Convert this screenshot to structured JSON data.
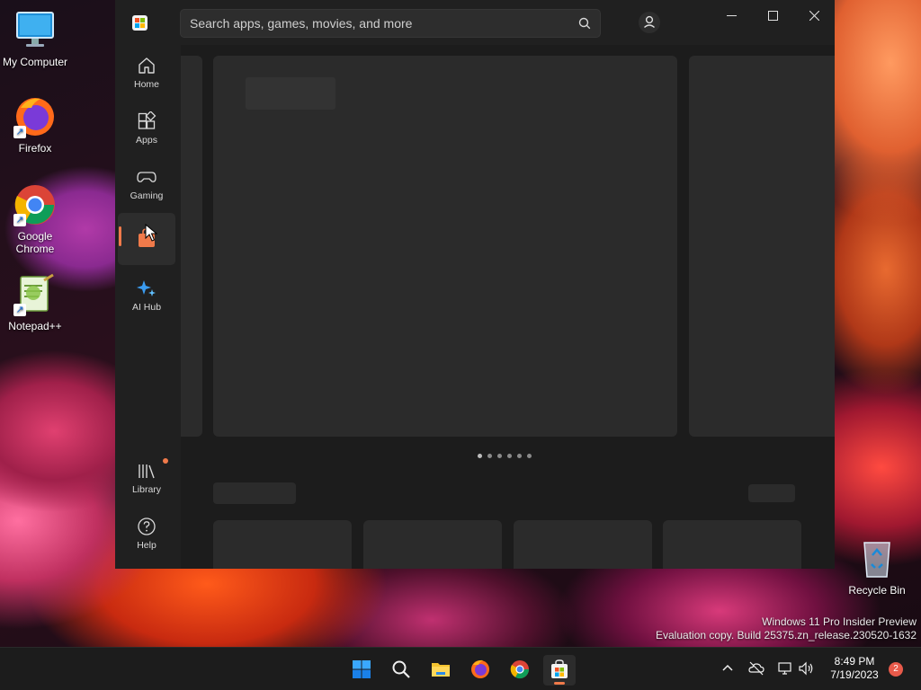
{
  "desktop": {
    "icons": [
      {
        "label": "My Computer"
      },
      {
        "label": "Firefox"
      },
      {
        "label": "Google Chrome"
      },
      {
        "label": "Notepad++"
      },
      {
        "label": "Recycle Bin"
      }
    ],
    "watermark": {
      "line1": "Windows 11 Pro Insider Preview",
      "line2": "Evaluation copy. Build 25375.zn_release.230520-1632"
    }
  },
  "store": {
    "search_placeholder": "Search apps, games, movies, and more",
    "nav": [
      {
        "label": "Home",
        "icon": "home-icon"
      },
      {
        "label": "Apps",
        "icon": "apps-icon"
      },
      {
        "label": "Gaming",
        "icon": "gamepad-icon"
      },
      {
        "label": "",
        "icon": "store-bag-icon"
      },
      {
        "label": "AI Hub",
        "icon": "ai-sparkle-icon"
      },
      {
        "label": "Library",
        "icon": "library-icon"
      },
      {
        "label": "Help",
        "icon": "help-icon"
      }
    ],
    "accent": "#f07a4a"
  },
  "taskbar": {
    "time": "8:49 PM",
    "date": "7/19/2023",
    "notifications": "2"
  }
}
